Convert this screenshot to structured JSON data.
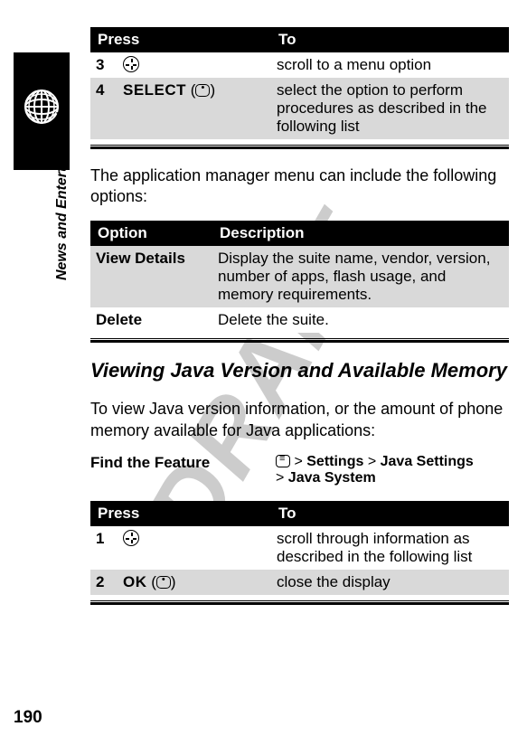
{
  "watermark": "DRAFT",
  "section_label": "News and Entertainment",
  "page_number": "190",
  "table1": {
    "head_press": "Press",
    "head_to": "To",
    "rows": [
      {
        "num": "3",
        "to": "scroll to a menu option"
      },
      {
        "num": "4",
        "press_label": "SELECT",
        "to": "select the option to perform procedures as described in the following list"
      }
    ]
  },
  "para1": "The application manager menu can include the following options:",
  "table2": {
    "head_option": "Option",
    "head_desc": "Description",
    "rows": [
      {
        "opt": "View Details",
        "desc": "Display the suite name, vendor, version, number of apps, flash usage, and memory requirements."
      },
      {
        "opt": "Delete",
        "desc": "Delete the suite."
      }
    ]
  },
  "heading": "Viewing Java Version and Available Memory",
  "para2": "To view Java version information, or the amount of phone memory available for Java applications:",
  "find": {
    "label": "Find the Feature",
    "path_parts": {
      "gt1": ">",
      "p1": "Settings",
      "gt2": ">",
      "p2": "Java Settings",
      "gt3": ">",
      "p3": "Java System"
    }
  },
  "table3": {
    "head_press": "Press",
    "head_to": "To",
    "rows": [
      {
        "num": "1",
        "to": "scroll through information as described in the following list"
      },
      {
        "num": "2",
        "press_label": "OK",
        "to": "close the display"
      }
    ]
  }
}
